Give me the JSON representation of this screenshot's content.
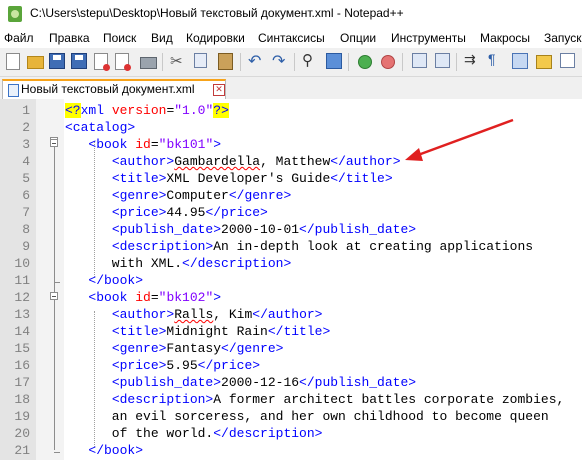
{
  "window": {
    "title": "C:\\Users\\stepu\\Desktop\\Новый текстовый документ.xml - Notepad++"
  },
  "menu": [
    "Файл",
    "Правка",
    "Поиск",
    "Вид",
    "Кодировки",
    "Синтаксисы",
    "Опции",
    "Инструменты",
    "Макросы",
    "Запуск"
  ],
  "toolbar": {
    "icons": [
      "new-file-icon",
      "open-file-icon",
      "save-icon",
      "save-all-icon",
      "close-file-icon",
      "close-all-icon",
      "print-icon",
      "cut-icon",
      "copy-icon",
      "paste-icon",
      "undo-icon",
      "redo-icon",
      "find-icon",
      "replace-icon",
      "zoom-in-icon",
      "zoom-out-icon",
      "sync-vertical-icon",
      "sync-horizontal-icon",
      "word-wrap-icon",
      "show-all-characters-icon",
      "indent-guide-icon",
      "user-language-icon",
      "document-map-icon"
    ]
  },
  "tab": {
    "label": "Новый текстовый документ.xml",
    "close": "✕"
  },
  "colors": {
    "tag": "#0000ff",
    "attribute": "#ff0000",
    "value": "#8000ff",
    "text": "#000000",
    "pi_highlight": "#ffff00",
    "arrow": "#e02020",
    "active_tab_accent": "#f7a31a"
  },
  "lines": [
    {
      "n": "1",
      "tokens": [
        {
          "c": "pi",
          "t": "<?"
        },
        {
          "c": "tag",
          "t": "xml "
        },
        {
          "c": "attr",
          "t": "version"
        },
        {
          "c": "text",
          "t": "="
        },
        {
          "c": "val",
          "t": "\"1.0\""
        },
        {
          "c": "pi",
          "t": "?>"
        }
      ]
    },
    {
      "n": "2",
      "tokens": [
        {
          "c": "tag",
          "t": "<catalog>"
        }
      ]
    },
    {
      "n": "3",
      "tokens": [
        {
          "c": "text",
          "t": "   "
        },
        {
          "c": "tag",
          "t": "<book "
        },
        {
          "c": "attr",
          "t": "id"
        },
        {
          "c": "text",
          "t": "="
        },
        {
          "c": "val",
          "t": "\"bk101\""
        },
        {
          "c": "tag",
          "t": ">"
        }
      ]
    },
    {
      "n": "4",
      "tokens": [
        {
          "c": "text",
          "t": "      "
        },
        {
          "c": "tag",
          "t": "<author>"
        },
        {
          "c": "squig",
          "t": "Gambardella"
        },
        {
          "c": "text",
          "t": ", Matthew"
        },
        {
          "c": "tag",
          "t": "</author>"
        }
      ]
    },
    {
      "n": "5",
      "tokens": [
        {
          "c": "text",
          "t": "      "
        },
        {
          "c": "tag",
          "t": "<title>"
        },
        {
          "c": "text",
          "t": "XML Developer's Guide"
        },
        {
          "c": "tag",
          "t": "</title>"
        }
      ]
    },
    {
      "n": "6",
      "tokens": [
        {
          "c": "text",
          "t": "      "
        },
        {
          "c": "tag",
          "t": "<genre>"
        },
        {
          "c": "text",
          "t": "Computer"
        },
        {
          "c": "tag",
          "t": "</genre>"
        }
      ]
    },
    {
      "n": "7",
      "tokens": [
        {
          "c": "text",
          "t": "      "
        },
        {
          "c": "tag",
          "t": "<price>"
        },
        {
          "c": "text",
          "t": "44.95"
        },
        {
          "c": "tag",
          "t": "</price>"
        }
      ]
    },
    {
      "n": "8",
      "tokens": [
        {
          "c": "text",
          "t": "      "
        },
        {
          "c": "tag",
          "t": "<publish_date>"
        },
        {
          "c": "text",
          "t": "2000-10-01"
        },
        {
          "c": "tag",
          "t": "</publish_date>"
        }
      ]
    },
    {
      "n": "9",
      "tokens": [
        {
          "c": "text",
          "t": "      "
        },
        {
          "c": "tag",
          "t": "<description>"
        },
        {
          "c": "text",
          "t": "An in-depth look at creating applications"
        }
      ]
    },
    {
      "n": "10",
      "tokens": [
        {
          "c": "text",
          "t": "      with XML."
        },
        {
          "c": "tag",
          "t": "</description>"
        }
      ]
    },
    {
      "n": "11",
      "tokens": [
        {
          "c": "text",
          "t": "   "
        },
        {
          "c": "tag",
          "t": "</book>"
        }
      ]
    },
    {
      "n": "12",
      "tokens": [
        {
          "c": "text",
          "t": "   "
        },
        {
          "c": "tag",
          "t": "<book "
        },
        {
          "c": "attr",
          "t": "id"
        },
        {
          "c": "text",
          "t": "="
        },
        {
          "c": "val",
          "t": "\"bk102\""
        },
        {
          "c": "tag",
          "t": ">"
        }
      ]
    },
    {
      "n": "13",
      "tokens": [
        {
          "c": "text",
          "t": "      "
        },
        {
          "c": "tag",
          "t": "<author>"
        },
        {
          "c": "squig",
          "t": "Ralls"
        },
        {
          "c": "text",
          "t": ", Kim"
        },
        {
          "c": "tag",
          "t": "</author>"
        }
      ]
    },
    {
      "n": "14",
      "tokens": [
        {
          "c": "text",
          "t": "      "
        },
        {
          "c": "tag",
          "t": "<title>"
        },
        {
          "c": "text",
          "t": "Midnight Rain"
        },
        {
          "c": "tag",
          "t": "</title>"
        }
      ]
    },
    {
      "n": "15",
      "tokens": [
        {
          "c": "text",
          "t": "      "
        },
        {
          "c": "tag",
          "t": "<genre>"
        },
        {
          "c": "text",
          "t": "Fantasy"
        },
        {
          "c": "tag",
          "t": "</genre>"
        }
      ]
    },
    {
      "n": "16",
      "tokens": [
        {
          "c": "text",
          "t": "      "
        },
        {
          "c": "tag",
          "t": "<price>"
        },
        {
          "c": "text",
          "t": "5.95"
        },
        {
          "c": "tag",
          "t": "</price>"
        }
      ]
    },
    {
      "n": "17",
      "tokens": [
        {
          "c": "text",
          "t": "      "
        },
        {
          "c": "tag",
          "t": "<publish_date>"
        },
        {
          "c": "text",
          "t": "2000-12-16"
        },
        {
          "c": "tag",
          "t": "</publish_date>"
        }
      ]
    },
    {
      "n": "18",
      "tokens": [
        {
          "c": "text",
          "t": "      "
        },
        {
          "c": "tag",
          "t": "<description>"
        },
        {
          "c": "text",
          "t": "A former architect battles corporate zombies,"
        }
      ]
    },
    {
      "n": "19",
      "tokens": [
        {
          "c": "text",
          "t": "      an evil sorceress, and her own childhood to become queen"
        }
      ]
    },
    {
      "n": "20",
      "tokens": [
        {
          "c": "text",
          "t": "      of the world."
        },
        {
          "c": "tag",
          "t": "</description>"
        }
      ]
    },
    {
      "n": "21",
      "tokens": [
        {
          "c": "text",
          "t": "   "
        },
        {
          "c": "tag",
          "t": "</book>"
        }
      ]
    }
  ]
}
